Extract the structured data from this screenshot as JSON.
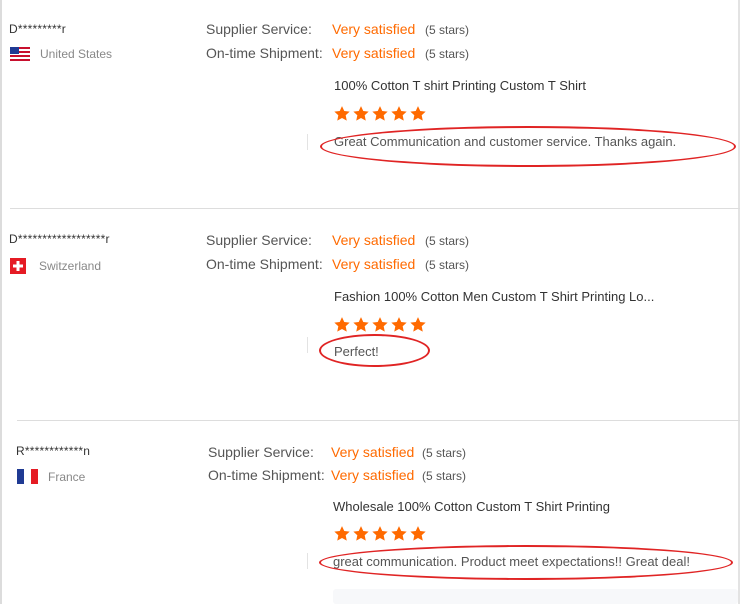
{
  "reviews": [
    {
      "buyer": "D*********r",
      "country": "United States",
      "flag": "us-flag",
      "supplier_service_label": "Supplier Service:",
      "supplier_service_value": "Very satisfied",
      "supplier_service_stars": "(5 stars)",
      "shipment_label": "On-time Shipment:",
      "shipment_value": "Very satisfied",
      "shipment_stars": "(5 stars)",
      "product": "100% Cotton T shirt Printing Custom T Shirt",
      "rating": 5,
      "comment": "Great Communication and customer service.  Thanks again."
    },
    {
      "buyer": "D******************r",
      "country": "Switzerland",
      "flag": "ch-flag",
      "supplier_service_label": "Supplier Service:",
      "supplier_service_value": "Very satisfied",
      "supplier_service_stars": "(5 stars)",
      "shipment_label": "On-time Shipment:",
      "shipment_value": "Very satisfied",
      "shipment_stars": "(5 stars)",
      "product": "Fashion 100% Cotton Men Custom T Shirt Printing Lo...",
      "rating": 5,
      "comment": "Perfect!"
    },
    {
      "buyer": "R************n",
      "country": "France",
      "flag": "fr-flag",
      "supplier_service_label": "Supplier Service:",
      "supplier_service_value": "Very satisfied",
      "supplier_service_stars": "(5 stars)",
      "shipment_label": "On-time Shipment:",
      "shipment_value": "Very satisfied",
      "shipment_stars": "(5 stars)",
      "product": "Wholesale 100% Cotton Custom T Shirt Printing",
      "rating": 5,
      "comment": "great communication. Product meet expectations!! Great deal!"
    }
  ],
  "colors": {
    "accent": "#ff6a00",
    "star": "#ff6a00",
    "highlight_oval": "#e02424",
    "divider": "#dddddd"
  }
}
